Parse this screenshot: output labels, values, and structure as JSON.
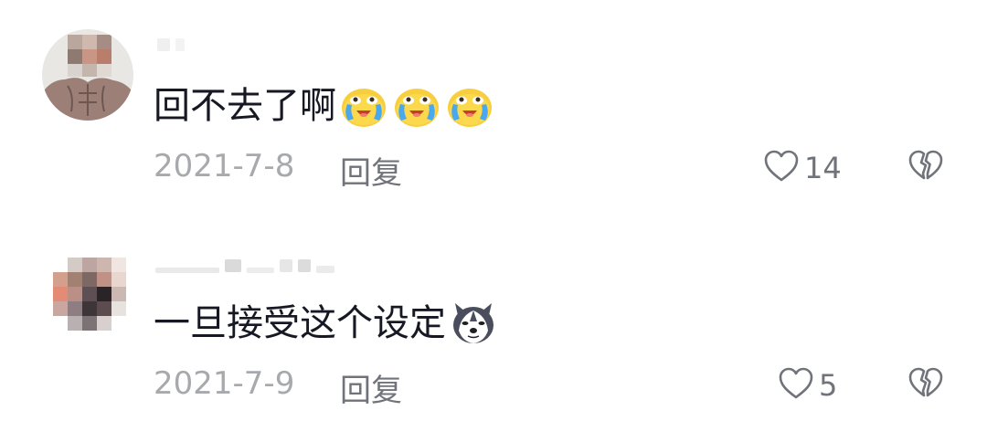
{
  "comments": [
    {
      "avatar": "avatar-icon",
      "text": "回不去了啊",
      "emojis": [
        "crying-laughing-emoji-icon",
        "crying-laughing-emoji-icon",
        "crying-laughing-emoji-icon"
      ],
      "date": "2021-7-8",
      "reply_label": "回复",
      "like_count": "14"
    },
    {
      "avatar": "avatar-icon",
      "text": "一旦接受这个设定",
      "emojis": [
        "husky-dog-emoji-icon"
      ],
      "date": "2021-7-9",
      "reply_label": "回复",
      "like_count": "5"
    }
  ],
  "icons": {
    "like": "heart-outline-icon",
    "dislike": "broken-heart-icon"
  },
  "colors": {
    "text_primary": "#161823",
    "text_secondary": "#a7a9ad",
    "icon_gray": "#70737a"
  }
}
